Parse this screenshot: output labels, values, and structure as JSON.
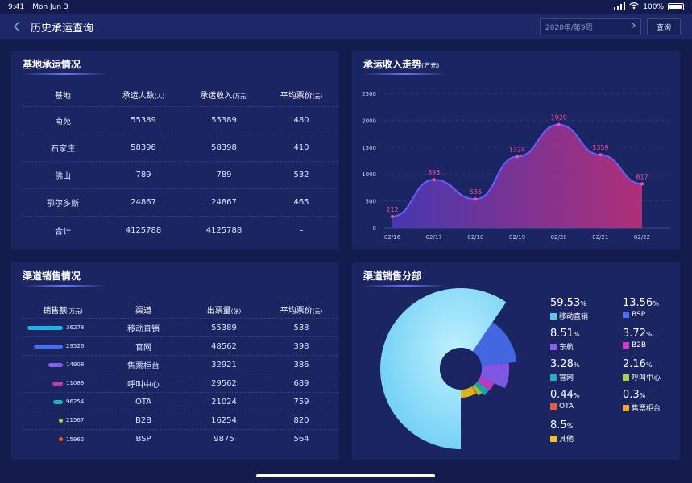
{
  "status_bar": {
    "time": "9:41",
    "date": "Mon Jun 3",
    "battery": "100%"
  },
  "header": {
    "title": "历史承运查询",
    "week_value": "2020年/第9周",
    "query_label": "查询"
  },
  "base_panel": {
    "title": "基地承运情况",
    "columns": [
      {
        "label": "基地",
        "unit": ""
      },
      {
        "label": "承运人数",
        "unit": "(人)"
      },
      {
        "label": "承运收入",
        "unit": "(万元)"
      },
      {
        "label": "平均票价",
        "unit": "(元)"
      }
    ],
    "rows": [
      [
        "南苑",
        "55389",
        "55389",
        "480"
      ],
      [
        "石家庄",
        "58398",
        "58398",
        "410"
      ],
      [
        "佛山",
        "789",
        "789",
        "532"
      ],
      [
        "鄂尔多斯",
        "24867",
        "24867",
        "465"
      ],
      [
        "合计",
        "4125788",
        "4125788",
        "–"
      ]
    ]
  },
  "trend_panel": {
    "title": "承运收入走势",
    "unit": "(万元)"
  },
  "chart_data": [
    {
      "type": "area",
      "title": "承运收入走势(万元)",
      "categories": [
        "02/16",
        "02/17",
        "02/18",
        "02/19",
        "02/20",
        "02/21",
        "02/22"
      ],
      "values": [
        212,
        895,
        536,
        1324,
        1920,
        1359,
        817
      ],
      "ylim": [
        0,
        2500
      ],
      "yticks": [
        0,
        500,
        1000,
        1500,
        2000,
        2500
      ],
      "grid": true,
      "line_color": "#6a5cff",
      "label_color": "#ff4fa8"
    },
    {
      "type": "pie",
      "title": "渠道销售分部",
      "labels": [
        "移动直销",
        "BSP",
        "东航",
        "B2B",
        "官网",
        "呼叫中心",
        "OTA",
        "售票柜台",
        "其他"
      ],
      "values": [
        59.53,
        13.56,
        8.51,
        3.72,
        3.28,
        2.16,
        0.44,
        0.3,
        8.5
      ],
      "colors": [
        "#5ec8f2",
        "#4a6ef0",
        "#8a5cf0",
        "#d83ac8",
        "#1cb3b0",
        "#a6d63a",
        "#f05a2a",
        "#f2a92a",
        "#f2c21a"
      ]
    }
  ],
  "channel_panel": {
    "title": "渠道销售情况",
    "columns": [
      {
        "label": "销售额",
        "unit": "(万元)"
      },
      {
        "label": "渠道",
        "unit": ""
      },
      {
        "label": "出票量",
        "unit": "(张)"
      },
      {
        "label": "平均票价",
        "unit": "(元)"
      }
    ],
    "rows": [
      {
        "sales": "36278",
        "sales_value": 36278,
        "channel": "移动直销",
        "tickets": "55389",
        "avg": "538",
        "color": "#17b5e8"
      },
      {
        "sales": "29526",
        "sales_value": 29526,
        "channel": "官网",
        "tickets": "48562",
        "avg": "398",
        "color": "#4a6ef0"
      },
      {
        "sales": "14908",
        "sales_value": 14908,
        "channel": "售票柜台",
        "tickets": "32921",
        "avg": "386",
        "color": "#8a5cf0"
      },
      {
        "sales": "11089",
        "sales_value": 11089,
        "channel": "呼叫中心",
        "tickets": "29562",
        "avg": "689",
        "color": "#c43aa8"
      },
      {
        "sales": "96254",
        "sales_value": 9625,
        "channel": "OTA",
        "tickets": "21024",
        "avg": "759",
        "color": "#1cb3b0"
      },
      {
        "sales": "21567",
        "sales_value": 2156,
        "channel": "B2B",
        "tickets": "16254",
        "avg": "820",
        "color": "#a6d63a"
      },
      {
        "sales": "15962",
        "sales_value": 1596,
        "channel": "BSP",
        "tickets": "9875",
        "avg": "564",
        "color": "#f05a2a"
      }
    ]
  },
  "distribution_panel": {
    "title": "渠道销售分部",
    "legend": [
      {
        "pct": "59.53",
        "label": "移动直销",
        "color": "#5ec8f2"
      },
      {
        "pct": "13.56",
        "label": "BSP",
        "color": "#4a6ef0"
      },
      {
        "pct": "8.51",
        "label": "东航",
        "color": "#8a5cf0"
      },
      {
        "pct": "3.72",
        "label": "B2B",
        "color": "#d83ac8"
      },
      {
        "pct": "3.28",
        "label": "官网",
        "color": "#1cb3b0"
      },
      {
        "pct": "2.16",
        "label": "呼叫中心",
        "color": "#a6d63a"
      },
      {
        "pct": "0.44",
        "label": "OTA",
        "color": "#f05a2a"
      },
      {
        "pct": "0.3",
        "label": "售票柜台",
        "color": "#f2a92a"
      },
      {
        "pct": "8.5",
        "label": "其他",
        "color": "#f2c21a"
      }
    ]
  }
}
